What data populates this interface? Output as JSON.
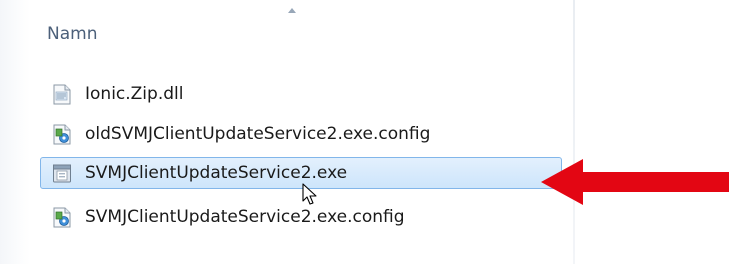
{
  "file_list": {
    "column_header": "Namn",
    "sort_direction": "ascending",
    "files": [
      {
        "name": "Ionic.Zip.dll",
        "icon": "dll-file-icon",
        "selected": false
      },
      {
        "name": "oldSVMJClientUpdateService2.exe.config",
        "icon": "config-file-icon",
        "selected": false
      },
      {
        "name": "SVMJClientUpdateService2.exe",
        "icon": "exe-file-icon",
        "selected": true
      },
      {
        "name": "SVMJClientUpdateService2.exe.config",
        "icon": "config-file-icon",
        "selected": false
      }
    ]
  },
  "annotation": {
    "arrow_color": "#e30613",
    "arrow_icon": "red-arrow-left-icon",
    "cursor_icon": "mouse-pointer-icon"
  },
  "colors": {
    "selection_fill": "#cde5fb",
    "selection_border": "#82b6ea",
    "header_text": "#4c607a"
  }
}
